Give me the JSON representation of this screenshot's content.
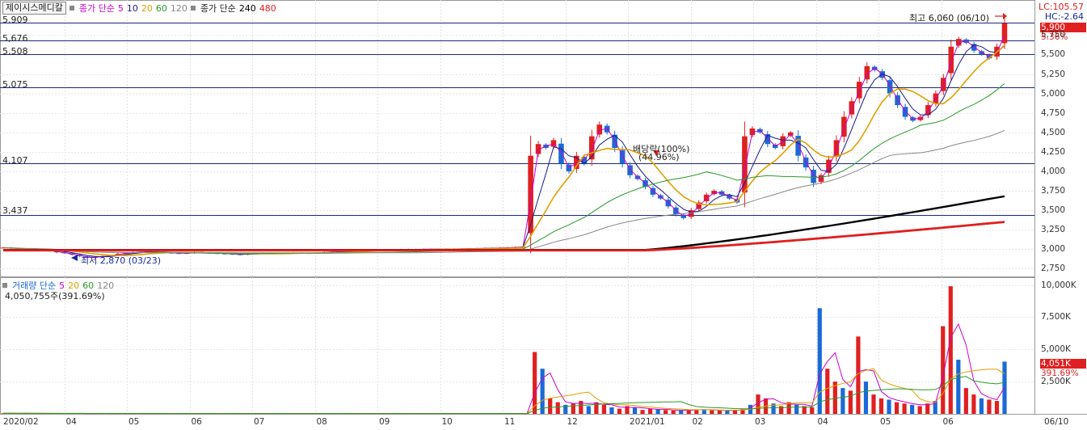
{
  "title": "제이시스메디칼",
  "legend_main": {
    "series_label": "종가 단순",
    "ma": [
      "5",
      "10",
      "20",
      "60",
      "120"
    ],
    "series_label2": "종가 단순",
    "ma2": [
      "240",
      "480"
    ]
  },
  "legend_vol": {
    "series_label": "거래량 단순",
    "ma": [
      "5",
      "20",
      "60",
      "120"
    ],
    "volume_text": "4,050,755주(391.69%)"
  },
  "colors": {
    "ma5": "#cc00cc",
    "ma10": "#1a1a8a",
    "ma20": "#e0a000",
    "ma60": "#2a9a2a",
    "ma120": "#888888",
    "ma240": "#000000",
    "ma480": "#e02020",
    "up": "#e02020",
    "down": "#1a6ad6"
  },
  "levels": [
    "5,909",
    "5,676",
    "5,508",
    "5,075",
    "4,107",
    "3,437"
  ],
  "side": {
    "lc": "LC:105.57",
    "hc": "HC:-2.64",
    "price_tag": "5,900",
    "pct_tag": "5.36%",
    "vol_tag": "4,051K",
    "vol_pct_tag": "391.69%"
  },
  "annotations": {
    "high": "최고 6,060 (06/10)",
    "low": "최저 2,870 (03/23)",
    "dividend": "배당락(100%)",
    "dividend_sub": "(44.96%)"
  },
  "chart_data": [
    {
      "type": "candlestick",
      "title": "",
      "y_ticks": [
        "5,750",
        "5,500",
        "5,250",
        "5,000",
        "4,750",
        "4,500",
        "4,250",
        "4,000",
        "3,750",
        "3,500",
        "3,250",
        "3,000",
        "2,750"
      ],
      "ylim": [
        2650,
        6200
      ],
      "x_ticks": [
        "2020/02",
        "04",
        "05",
        "06",
        "07",
        "08",
        "09",
        "10",
        "11",
        "12",
        "2021/01",
        "02",
        "03",
        "04",
        "05",
        "06",
        "06/10"
      ],
      "horizontal_levels": [
        5909,
        5676,
        5508,
        5075,
        4107,
        3437
      ],
      "close": [
        3020,
        3010,
        3005,
        2995,
        3000,
        2990,
        2980,
        2960,
        2950,
        2930,
        2910,
        2890,
        2900,
        2910,
        2920,
        2940,
        2950,
        2960,
        2965,
        2970,
        2960,
        2955,
        2950,
        2945,
        2950,
        2960,
        2955,
        2950,
        2945,
        2940,
        2935,
        2930,
        2940,
        2945,
        2950,
        2948,
        2946,
        2950,
        2952,
        2950,
        2948,
        2952,
        2960,
        2965,
        2970,
        2975,
        2980,
        2985,
        2990,
        2990,
        2992,
        2995,
        2996,
        2998,
        2998,
        3000,
        3000,
        3000,
        3002,
        3004,
        3006,
        3008,
        3010,
        3012,
        3015,
        3018,
        3020,
        3025,
        3030,
        4200,
        4350,
        4300,
        4400,
        4100,
        4000,
        4200,
        4100,
        4450,
        4600,
        4500,
        4300,
        4100,
        3950,
        3900,
        3800,
        3700,
        3650,
        3550,
        3450,
        3400,
        3500,
        3600,
        3700,
        3750,
        3700,
        3650,
        3600,
        4450,
        4550,
        4500,
        4350,
        4300,
        4450,
        4500,
        4200,
        4050,
        3850,
        3950,
        4150,
        4400,
        4700,
        4900,
        5150,
        5350,
        5300,
        5200,
        5000,
        4850,
        4700,
        4650,
        4700,
        4850,
        5000,
        5200,
        5600,
        5700,
        5650,
        5550,
        5500,
        5450,
        5600,
        5900
      ],
      "ma_series": [
        {
          "name": "240",
          "last": 3680
        },
        {
          "name": "480",
          "last": 3350
        }
      ]
    },
    {
      "type": "bar",
      "title": "",
      "y_ticks": [
        "10,000K",
        "7,500K",
        "5,000K",
        "2,500K"
      ],
      "ylim": [
        0,
        10600
      ],
      "last_volume_k": 4051,
      "values_k": [
        50,
        40,
        30,
        45,
        35,
        30,
        25,
        40,
        30,
        25,
        30,
        20,
        25,
        30,
        20,
        25,
        30,
        25,
        20,
        30,
        25,
        20,
        30,
        25,
        20,
        30,
        25,
        20,
        30,
        25,
        20,
        25,
        30,
        20,
        25,
        30,
        20,
        25,
        30,
        20,
        25,
        30,
        20,
        25,
        30,
        20,
        25,
        30,
        20,
        25,
        30,
        20,
        25,
        30,
        20,
        25,
        30,
        20,
        25,
        30,
        20,
        25,
        30,
        20,
        25,
        30,
        20,
        25,
        30,
        4800,
        3500,
        1200,
        900,
        700,
        800,
        1000,
        600,
        900,
        700,
        500,
        400,
        600,
        500,
        300,
        400,
        350,
        300,
        250,
        280,
        300,
        350,
        320,
        280,
        260,
        240,
        300,
        350,
        700,
        1500,
        1200,
        800,
        600,
        900,
        700,
        600,
        500,
        8200,
        3500,
        2500,
        2000,
        1800,
        6000,
        2500,
        1500,
        1200,
        1100,
        900,
        800,
        700,
        600,
        800,
        1000,
        6800,
        9900,
        4200,
        2000,
        1500,
        1200,
        1100,
        1000,
        4051
      ]
    }
  ]
}
